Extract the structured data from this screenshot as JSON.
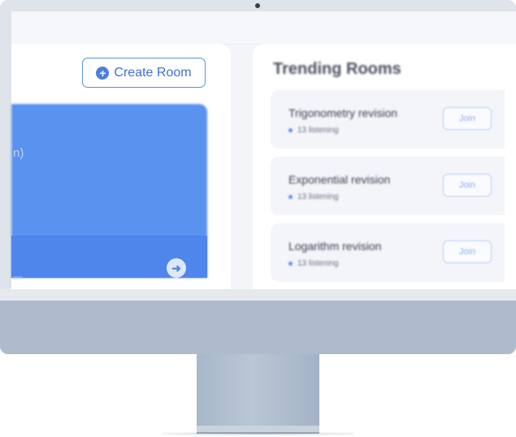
{
  "actions": {
    "create_room_label": "Create Room"
  },
  "left_card": {
    "title_fragment": "n)",
    "footer_fragment": "ms"
  },
  "trending": {
    "title": "Trending Rooms",
    "rooms": [
      {
        "name": "Trigonometry revision",
        "listeners": "13 listening",
        "join_label": "Join"
      },
      {
        "name": "Exponential revision",
        "listeners": "13 listening",
        "join_label": "Join"
      },
      {
        "name": "Logarithm revision",
        "listeners": "13 listening",
        "join_label": "Join"
      }
    ]
  },
  "icons": {
    "create": "plus-circle-icon",
    "open": "arrow-right-circle-icon",
    "status": "live-dot-icon"
  },
  "colors": {
    "accent": "#4a7ee0",
    "card_blue": "#5a92f0",
    "monitor_chin": "#aebbcd"
  }
}
